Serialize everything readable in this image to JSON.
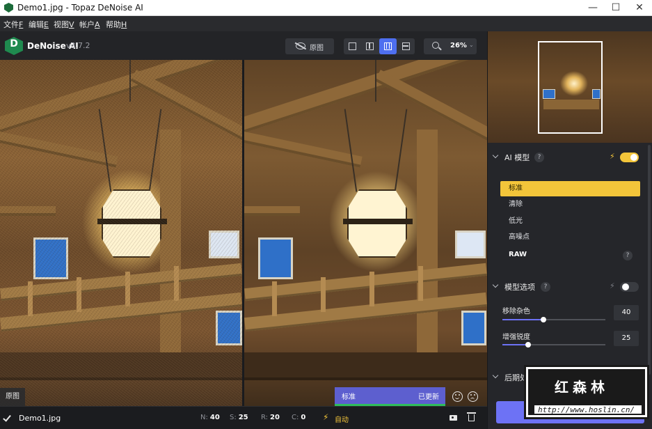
{
  "window": {
    "title": "Demo1.jpg - Topaz DeNoise AI",
    "minimize": "—",
    "maximize": "☐",
    "close": "✕"
  },
  "menu": [
    {
      "label": "文件",
      "key": "F"
    },
    {
      "label": "编辑",
      "key": "E"
    },
    {
      "label": "视图",
      "key": "V"
    },
    {
      "label": "帐户",
      "key": "A"
    },
    {
      "label": "帮助",
      "key": "H"
    }
  ],
  "toolbar": {
    "logo_letter": "D",
    "brand": "DeNoise AI",
    "version": "v3.7.2",
    "original_label": "原图",
    "zoom": "26%",
    "zoom_chevron": "⌄",
    "views": [
      "single-view",
      "split-view",
      "side-by-side-view",
      "quad-view"
    ],
    "active_view": "side-by-side-view"
  },
  "canvas": {
    "original_badge": "原图"
  },
  "model_banner": {
    "name": "标准",
    "status": "已更新",
    "progress_fraction": 1.0
  },
  "statusbar": {
    "filename": "Demo1.jpg",
    "stats": [
      {
        "key": "N:",
        "value": "40"
      },
      {
        "key": "S:",
        "value": "25"
      },
      {
        "key": "R:",
        "value": "20"
      },
      {
        "key": "C:",
        "value": "0"
      }
    ],
    "auto_label": "自动",
    "bolt": "⚡"
  },
  "panel": {
    "ai_model": {
      "title": "AI 模型",
      "help": "?",
      "bolt": "⚡",
      "enabled": true,
      "items": [
        "标准",
        "清除",
        "低光",
        "高噪点",
        "RAW"
      ],
      "selected_index": 0,
      "raw_help": "?"
    },
    "model_options": {
      "title": "模型选项",
      "help": "?",
      "bolt": "⚡",
      "enabled": false,
      "remove_noise": {
        "label": "移除杂色",
        "value": "40",
        "fraction": 0.4
      },
      "enhance_sharpness": {
        "label": "增强锐度",
        "value": "25",
        "fraction": 0.25
      }
    },
    "post": {
      "title": "后期处理",
      "help": "?"
    }
  },
  "watermark": {
    "title": "红森林",
    "url": "http://www.hoslin.cn/"
  },
  "colors": {
    "accent": "#f3c53a",
    "primary": "#6d72f5",
    "banner": "#5d5fcf",
    "progress": "#2fbd5c",
    "background": "#1e1f22"
  }
}
